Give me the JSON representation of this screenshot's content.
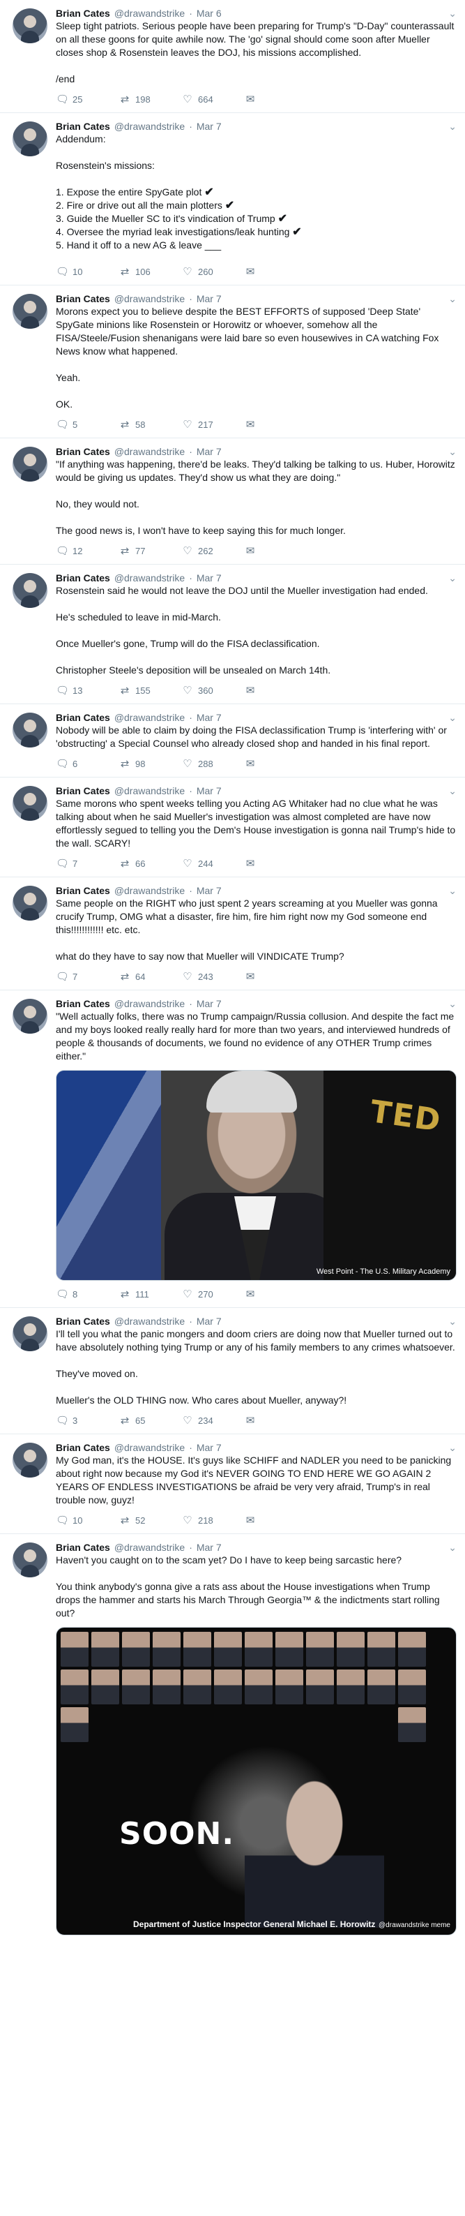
{
  "author": {
    "name": "Brian Cates",
    "handle": "@drawandstrike"
  },
  "tweets": [
    {
      "date": "Mar 6",
      "paragraphs": [
        "Sleep tight patriots. Serious people have been preparing for Trump's \"D-Day\" counterassault on all these goons for quite awhile now. The 'go' signal should come soon after Mueller closes shop & Rosenstein leaves the DOJ, his missions accomplished.",
        "/end"
      ],
      "replies": "25",
      "retweets": "198",
      "likes": "664"
    },
    {
      "date": "Mar 7",
      "intro": [
        "Addendum:",
        "Rosenstein's missions:"
      ],
      "list": [
        {
          "text": "1. Expose the entire SpyGate plot",
          "check": "✔"
        },
        {
          "text": "2. Fire or drive out all the main plotters",
          "check": "✔"
        },
        {
          "text": "3. Guide the Mueller SC to it's vindication of Trump",
          "check": "✔"
        },
        {
          "text": "4. Oversee the myriad leak investigations/leak hunting",
          "check": "✔"
        },
        {
          "text": "5. Hand it off to a new AG & leave ___",
          "check": ""
        }
      ],
      "replies": "10",
      "retweets": "106",
      "likes": "260"
    },
    {
      "date": "Mar 7",
      "paragraphs": [
        "Morons expect you to believe despite the BEST EFFORTS of supposed 'Deep State' SpyGate minions like Rosenstein or Horowitz or whoever, somehow all the FISA/Steele/Fusion shenanigans were laid bare so even housewives in CA watching Fox News know what happened.",
        "Yeah.",
        "OK."
      ],
      "replies": "5",
      "retweets": "58",
      "likes": "217"
    },
    {
      "date": "Mar 7",
      "paragraphs": [
        "\"If anything was happening, there'd be leaks. They'd talking be talking to us. Huber, Horowitz would be giving us updates.  They'd show us what they are doing.\"",
        "No, they would not.",
        "The good news is, I won't have to keep saying this for much longer."
      ],
      "replies": "12",
      "retweets": "77",
      "likes": "262"
    },
    {
      "date": "Mar 7",
      "paragraphs": [
        "Rosenstein said he would not leave the DOJ until the Mueller investigation had ended.",
        "He's scheduled to leave in mid-March.",
        "Once Mueller's gone, Trump will do the FISA declassification.",
        "Christopher Steele's deposition will be unsealed on March 14th."
      ],
      "replies": "13",
      "retweets": "155",
      "likes": "360"
    },
    {
      "date": "Mar 7",
      "paragraphs": [
        "Nobody will be able to claim by doing the FISA declassification Trump is 'interfering with' or 'obstructing' a Special Counsel who already closed shop and handed in his final report."
      ],
      "replies": "6",
      "retweets": "98",
      "likes": "288"
    },
    {
      "date": "Mar 7",
      "paragraphs": [
        "Same morons who spent weeks telling you Acting AG Whitaker had no clue what he was talking about when he said Mueller's investigation was almost completed are have now effortlessly segued to telling you the Dem's House investigation is gonna nail Trump's hide to the wall. SCARY!"
      ],
      "replies": "7",
      "retweets": "66",
      "likes": "244"
    },
    {
      "date": "Mar 7",
      "paragraphs": [
        "Same people on the RIGHT who just spent 2 years screaming at you Mueller was gonna crucify Trump, OMG what a disaster, fire him, fire him right now my God someone end this!!!!!!!!!!!! etc. etc.",
        "what do they have to say now that Mueller will VINDICATE Trump?"
      ],
      "replies": "7",
      "retweets": "64",
      "likes": "243"
    },
    {
      "date": "Mar 7",
      "paragraphs": [
        "\"Well actually folks, there was no Trump campaign/Russia collusion. And despite the fact me and my boys looked really really hard for more than two years, and interviewed hundreds of people & thousands of documents, we found no evidence of any OTHER Trump crimes either.\""
      ],
      "image_caption": "West Point - The U.S. Military Academy",
      "image_flag_text": "TED",
      "replies": "8",
      "retweets": "111",
      "likes": "270"
    },
    {
      "date": "Mar 7",
      "paragraphs": [
        "I'll tell you what the panic mongers and doom criers are doing now that Mueller turned out to have absolutely nothing tying Trump or any of his family members to any crimes whatsoever.",
        "They've moved on.",
        "Mueller's the OLD THING now.  Who cares about Mueller, anyway?!"
      ],
      "replies": "3",
      "retweets": "65",
      "likes": "234"
    },
    {
      "date": "Mar 7",
      "paragraphs": [
        "My God man, it's the HOUSE. It's guys like SCHIFF and NADLER you need to be panicking about right now because my God it's NEVER GOING TO END HERE WE GO AGAIN 2 YEARS OF ENDLESS INVESTIGATIONS be afraid be very very afraid, Trump's in real trouble now, guyz!"
      ],
      "replies": "10",
      "retweets": "52",
      "likes": "218"
    },
    {
      "date": "Mar 7",
      "paragraphs": [
        "Haven't you caught on to the scam yet?  Do I have to keep being sarcastic here?",
        "You think anybody's gonna give a rats ass about the House investigations when Trump drops the hammer and starts his March Through Georgia™ & the indictments start rolling out?"
      ],
      "image_word": "SOON.",
      "image_caption": "Department of Justice Inspector General Michael E. Horowitz",
      "image_credit": "@drawandstrike meme"
    }
  ],
  "icons": {
    "reply": "reply-icon",
    "retweet": "retweet-icon",
    "like": "heart-icon",
    "mail": "mail-icon",
    "caret": "chevron-down-icon"
  },
  "glyphs": {
    "dot": "·",
    "caret": "⌄"
  }
}
